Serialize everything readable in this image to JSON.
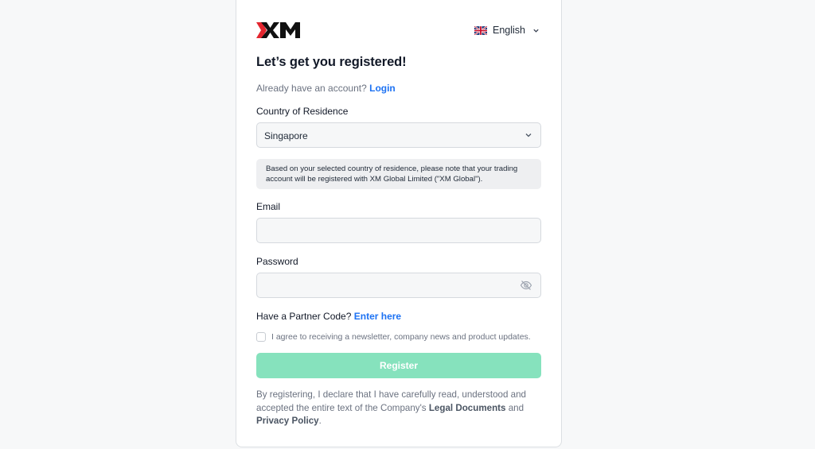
{
  "brand": {
    "logo_text": "XM",
    "accent": "#e3262f"
  },
  "language": {
    "selected": "English",
    "flag_icon": "uk-flag-icon"
  },
  "heading": "Let’s get you registered!",
  "login_prompt": {
    "text": "Already have an account? ",
    "link": "Login"
  },
  "country": {
    "label": "Country of Residence",
    "value": "Singapore",
    "notice": "Based on your selected country of residence, please note that your trading account will be registered with XM Global Limited (\"XM Global\")."
  },
  "email": {
    "label": "Email",
    "value": "",
    "placeholder": ""
  },
  "password": {
    "label": "Password",
    "value": "",
    "placeholder": ""
  },
  "partner": {
    "text": "Have a Partner Code? ",
    "link": "Enter here"
  },
  "newsletter": {
    "checked": false,
    "label": "I agree to receiving a newsletter, company news and product updates."
  },
  "register_button": {
    "label": "Register",
    "color": "#86e2bd"
  },
  "legal": {
    "text1": "By registering, I declare that I have carefully read, understood and accepted the entire text of the Company's ",
    "link1": "Legal Documents",
    "text2": " and ",
    "link2": "Privacy Policy",
    "text3": "."
  },
  "colors": {
    "link": "#1d72f3",
    "background": "#f7f8f9"
  }
}
